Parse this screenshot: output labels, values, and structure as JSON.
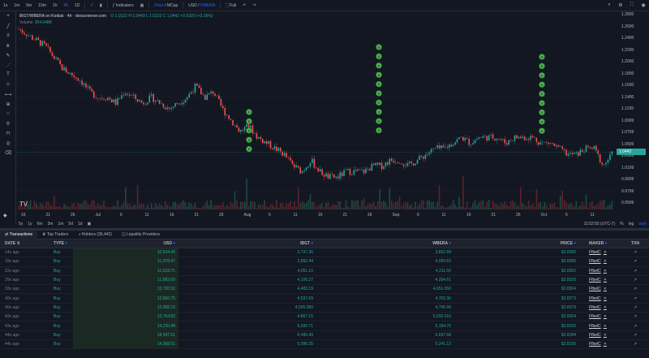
{
  "toolbar": {
    "intervals": [
      "1s",
      "1m",
      "5m",
      "15m",
      "1h",
      "4h",
      "1D"
    ],
    "active_interval": "4h",
    "indicators_label": "Indicators",
    "price_label": "Price",
    "mcap_label": "MCap",
    "usd_label": "USD",
    "wbera_label": "WBERA",
    "full_label": "Full"
  },
  "legend": {
    "symbol": "iBGT/WBERA on Kodiak · 4h · dexscreener.com",
    "ohlc": "O 1.0122 H 1.0443 L 1.0122 C 1.0442 +0.0320 (+3.16%)",
    "volume_label": "Volume",
    "volume_value": "364.648K"
  },
  "chart_data": {
    "type": "candlestick",
    "y_ticks": [
      "1.2800",
      "1.2600",
      "1.2400",
      "1.2200",
      "1.2000",
      "1.1800",
      "1.1600",
      "1.1400",
      "1.1199",
      "1.0999",
      "1.0799",
      "1.0599",
      "1.0399",
      "1.0199",
      "0.9999",
      "0.9799",
      "0.9599"
    ],
    "current_price": "1.0442",
    "x_ticks": [
      "16",
      "21",
      "26",
      "Jul",
      "6",
      "11",
      "16",
      "21",
      "26",
      "Aug",
      "6",
      "11",
      "16",
      "21",
      "26",
      "Sep",
      "6",
      "11",
      "16",
      "21",
      "26",
      "Oct",
      "6",
      "11"
    ],
    "ylim": [
      0.955,
      1.285
    ],
    "close_path": [
      1.26,
      1.25,
      1.24,
      1.23,
      1.21,
      1.19,
      1.18,
      1.17,
      1.15,
      1.14,
      1.14,
      1.13,
      1.15,
      1.14,
      1.13,
      1.14,
      1.13,
      1.12,
      1.13,
      1.14,
      1.16,
      1.14,
      1.15,
      1.12,
      1.1,
      1.08,
      1.09,
      1.07,
      1.06,
      1.05,
      1.04,
      1.02,
      1.01,
      1.03,
      1.01,
      1.0,
      1.0,
      1.01,
      1.01,
      1.01,
      1.02,
      1.02,
      1.03,
      1.03,
      1.02,
      1.03,
      1.04,
      1.05,
      1.05,
      1.06,
      1.07,
      1.06,
      1.07,
      1.07,
      1.07,
      1.06,
      1.07,
      1.07,
      1.07,
      1.06,
      1.06,
      1.05,
      1.04,
      1.04,
      1.05,
      1.05,
      1.02,
      1.04
    ]
  },
  "axis": {
    "ranges": [
      "5y",
      "1y",
      "6m",
      "3m",
      "1m",
      "5d",
      "1d"
    ],
    "clock": "11:52:55 (UTC-7)",
    "pct_label": "%",
    "log_label": "log",
    "auto_label": "auto"
  },
  "tabs": {
    "transactions": "Transactions",
    "top_traders": "Top Traders",
    "holders": "Holders (36,442)",
    "liquidity": "Liquidity Providers"
  },
  "columns": {
    "date": "DATE",
    "type": "TYPE",
    "usd": "USD",
    "ibgt": "IBGT",
    "wbera": "WBERA",
    "price": "PRICE",
    "maker": "MAKER",
    "txn": "TXN"
  },
  "rows": [
    {
      "date": "14s ago",
      "type": "Buy",
      "usd": "10,634.40",
      "ibgt": "3,737.36",
      "wbera": "3,892.89",
      "price": "$2.8382",
      "maker": "FfbelC"
    },
    {
      "date": "15s ago",
      "type": "Buy",
      "usd": "11,078.47",
      "ibgt": "3,892.44",
      "wbera": "4,050.63",
      "price": "$2.8389",
      "maker": "FfbelC"
    },
    {
      "date": "22s ago",
      "type": "Buy",
      "usd": "11,518.71",
      "ibgt": "4,051.10",
      "wbera": "4,211.60",
      "price": "$2.8362",
      "maker": "FfbelC"
    },
    {
      "date": "29s ago",
      "type": "Buy",
      "usd": "11,683.69",
      "ibgt": "4,106.27",
      "wbera": "4,264.61",
      "price": "$2.8333",
      "maker": "FfbelC"
    },
    {
      "date": "33s ago",
      "type": "Buy",
      "usd": "12,720.52",
      "ibgt": "4,483.19",
      "wbera": "4,651.050",
      "price": "$2.8304",
      "maker": "FfbelC"
    },
    {
      "date": "40s ago",
      "type": "Buy",
      "usd": "12,860.75",
      "ibgt": "4,537.69",
      "wbera": "4,702.30",
      "price": "$2.8273",
      "maker": "FfbelC"
    },
    {
      "date": "40s ago",
      "type": "Buy",
      "usd": "12,998.15",
      "ibgt": "4,595.080",
      "wbera": "4,745.99",
      "price": "$2.8279",
      "maker": "FfbelC"
    },
    {
      "date": "42s ago",
      "type": "Buy",
      "usd": "13,764.83",
      "ibgt": "4,867.15",
      "wbera": "5,032.010",
      "price": "$2.8254",
      "maker": "FfbelC"
    },
    {
      "date": "43s ago",
      "type": "Buy",
      "usd": "14,230.48",
      "ibgt": "5,030.71",
      "wbera": "5,194.70",
      "price": "$2.8220",
      "maker": "FfbelC"
    },
    {
      "date": "44s ago",
      "type": "Buy",
      "usd": "18,347.51",
      "ibgt": "6,495.49",
      "wbera": "6,697.58",
      "price": "$2.8184",
      "maker": "FfbelC"
    },
    {
      "date": "44s ago",
      "type": "Buy",
      "usd": "14,368.51",
      "ibgt": "5,090.35",
      "wbera": "5,241.13",
      "price": "$2.8156",
      "maker": "FfbelC"
    }
  ],
  "colors": {
    "bg": "#131722",
    "up": "#26a69a",
    "down": "#ef5350",
    "accent": "#2962ff"
  }
}
